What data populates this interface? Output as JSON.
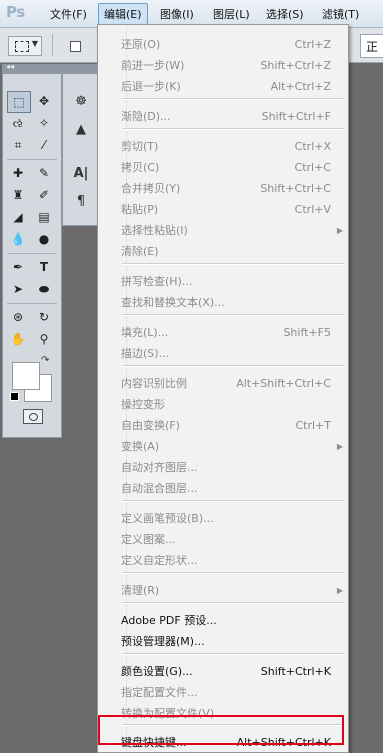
{
  "menubar": {
    "logo": "Ps",
    "items": [
      "文件(F)",
      "编辑(E)",
      "图像(I)",
      "图层(L)",
      "选择(S)",
      "滤镜(T)"
    ]
  },
  "options_bar": {
    "partial_text": "正"
  },
  "edit_menu": {
    "groups": [
      [
        {
          "label": "还原(O)",
          "shortcut": "Ctrl+Z",
          "enabled": false
        },
        {
          "label": "前进一步(W)",
          "shortcut": "Shift+Ctrl+Z",
          "enabled": false
        },
        {
          "label": "后退一步(K)",
          "shortcut": "Alt+Ctrl+Z",
          "enabled": false
        }
      ],
      [
        {
          "label": "渐隐(D)...",
          "shortcut": "Shift+Ctrl+F",
          "enabled": false
        }
      ],
      [
        {
          "label": "剪切(T)",
          "shortcut": "Ctrl+X",
          "enabled": false
        },
        {
          "label": "拷贝(C)",
          "shortcut": "Ctrl+C",
          "enabled": false
        },
        {
          "label": "合并拷贝(Y)",
          "shortcut": "Shift+Ctrl+C",
          "enabled": false
        },
        {
          "label": "粘贴(P)",
          "shortcut": "Ctrl+V",
          "enabled": false
        },
        {
          "label": "选择性粘贴(I)",
          "shortcut": "",
          "enabled": false,
          "submenu": true
        },
        {
          "label": "清除(E)",
          "shortcut": "",
          "enabled": false
        }
      ],
      [
        {
          "label": "拼写检查(H)...",
          "shortcut": "",
          "enabled": false
        },
        {
          "label": "查找和替换文本(X)...",
          "shortcut": "",
          "enabled": false
        }
      ],
      [
        {
          "label": "填充(L)...",
          "shortcut": "Shift+F5",
          "enabled": false
        },
        {
          "label": "描边(S)...",
          "shortcut": "",
          "enabled": false
        }
      ],
      [
        {
          "label": "内容识别比例",
          "shortcut": "Alt+Shift+Ctrl+C",
          "enabled": false
        },
        {
          "label": "操控变形",
          "shortcut": "",
          "enabled": false
        },
        {
          "label": "自由变换(F)",
          "shortcut": "Ctrl+T",
          "enabled": false
        },
        {
          "label": "变换(A)",
          "shortcut": "",
          "enabled": false,
          "submenu": true
        },
        {
          "label": "自动对齐图层...",
          "shortcut": "",
          "enabled": false
        },
        {
          "label": "自动混合图层...",
          "shortcut": "",
          "enabled": false
        }
      ],
      [
        {
          "label": "定义画笔预设(B)...",
          "shortcut": "",
          "enabled": false
        },
        {
          "label": "定义图案...",
          "shortcut": "",
          "enabled": false
        },
        {
          "label": "定义自定形状...",
          "shortcut": "",
          "enabled": false
        }
      ],
      [
        {
          "label": "清理(R)",
          "shortcut": "",
          "enabled": false,
          "submenu": true
        }
      ],
      [
        {
          "label": "Adobe PDF 预设...",
          "shortcut": "",
          "enabled": true
        },
        {
          "label": "预设管理器(M)...",
          "shortcut": "",
          "enabled": true
        }
      ],
      [
        {
          "label": "颜色设置(G)...",
          "shortcut": "Shift+Ctrl+K",
          "enabled": true
        },
        {
          "label": "指定配置文件...",
          "shortcut": "",
          "enabled": false
        },
        {
          "label": "转换为配置文件(V)...",
          "shortcut": "",
          "enabled": false
        }
      ],
      [
        {
          "label": "键盘快捷键...",
          "shortcut": "Alt+Shift+Ctrl+K",
          "enabled": true,
          "highlighted": true
        }
      ]
    ]
  },
  "colors": {
    "highlight_border": "#e3001b",
    "disabled_text": "#8c8c8c"
  }
}
